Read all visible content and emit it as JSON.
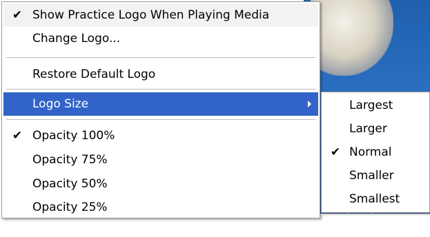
{
  "menu": {
    "items": [
      {
        "label": "Show Practice Logo When Playing Media",
        "checked": true
      },
      {
        "label": "Change Logo...",
        "checked": false
      },
      {
        "label": "Restore Default Logo",
        "checked": false
      },
      {
        "label": "Logo Size",
        "checked": false,
        "has_submenu": true
      },
      {
        "label": "Opacity 100%",
        "checked": true
      },
      {
        "label": "Opacity 75%",
        "checked": false
      },
      {
        "label": "Opacity 50%",
        "checked": false
      },
      {
        "label": "Opacity 25%",
        "checked": false
      }
    ],
    "check_glyph": "✔"
  },
  "submenu": {
    "items": [
      {
        "label": "Largest",
        "checked": false
      },
      {
        "label": "Larger",
        "checked": false
      },
      {
        "label": "Normal",
        "checked": true
      },
      {
        "label": "Smaller",
        "checked": false
      },
      {
        "label": "Smallest",
        "checked": false
      }
    ]
  },
  "colors": {
    "highlight": "#3163c9",
    "background_app": "#1f5fae"
  },
  "icons": {
    "submenu_arrow": "chevron-right-icon",
    "check": "check-icon"
  }
}
